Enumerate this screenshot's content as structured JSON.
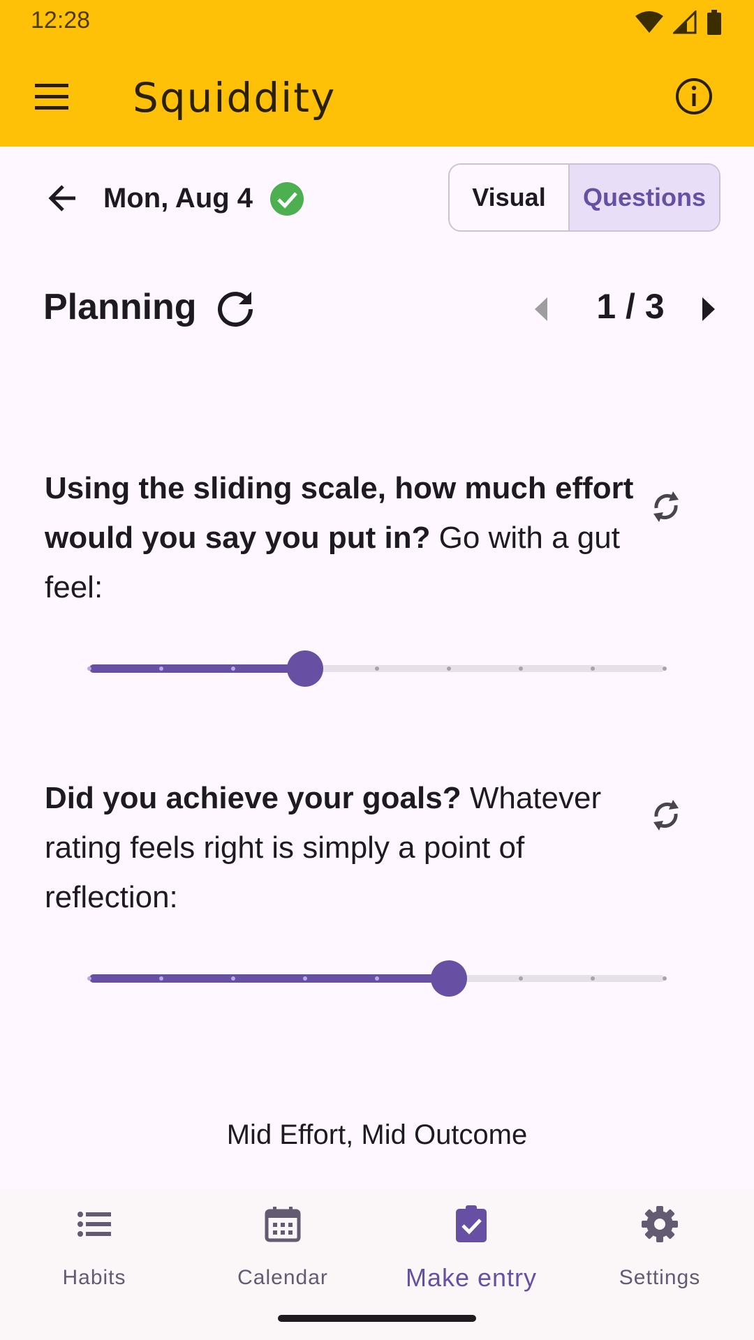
{
  "status_bar": {
    "time": "12:28"
  },
  "app_bar": {
    "title": "Squiddity"
  },
  "header": {
    "date": "Mon, Aug 4",
    "segments": [
      "Visual",
      "Questions"
    ],
    "selected_segment": "Questions"
  },
  "section": {
    "title": "Planning",
    "pager": "1 / 3"
  },
  "questions": [
    {
      "bold": "Using the sliding scale, how much effort would you say you put in?",
      "rest": " Go with a gut feel:",
      "slider_steps": 9,
      "slider_value_index": 3
    },
    {
      "bold": "Did you achieve your goals?",
      "rest": " Whatever rating feels right is simply a point of reflection:",
      "slider_steps": 9,
      "slider_value_index": 5
    }
  ],
  "summary": "Mid Effort, Mid Outcome",
  "bottom_nav": [
    {
      "label": "Habits",
      "icon": "list-icon",
      "active": false
    },
    {
      "label": "Calendar",
      "icon": "calendar-icon",
      "active": false
    },
    {
      "label": "Make entry",
      "icon": "clipboard-check-icon",
      "active": true
    },
    {
      "label": "Settings",
      "icon": "gear-icon",
      "active": false
    }
  ],
  "colors": {
    "app_bar": "#ffc107",
    "accent": "#6750a4",
    "check": "#4caf50",
    "background": "#fef7ff"
  }
}
